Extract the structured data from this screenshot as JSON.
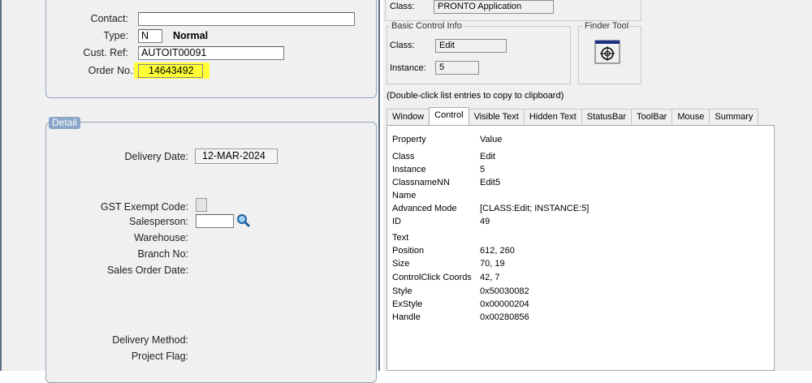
{
  "header": {
    "contact_label": "Contact:",
    "contact_value": "",
    "type_label": "Type:",
    "type_code": "N",
    "type_desc": "Normal",
    "custref_label": "Cust. Ref:",
    "custref_value": "AUTOIT00091",
    "orderno_label": "Order No.:",
    "orderno_value": "14643492"
  },
  "detail": {
    "legend": "Detail",
    "delivery_date_label": "Delivery Date:",
    "delivery_date_value": "12-MAR-2024",
    "gst_label": "GST Exempt Code:",
    "salesperson_label": "Salesperson:",
    "warehouse_label": "Warehouse:",
    "branch_label": "Branch No:",
    "sales_order_date_label": "Sales Order Date:",
    "delivery_method_label": "Delivery Method:",
    "project_flag_label": "Project Flag:"
  },
  "tool": {
    "window_class_label": "Class:",
    "window_class_value": "PRONTO Application",
    "basic_control_title": "Basic Control Info",
    "control_class_label": "Class:",
    "control_class_value": "Edit",
    "instance_label": "Instance:",
    "instance_value": "5",
    "finder_title": "Finder Tool",
    "hint": "(Double-click list entries to copy to clipboard)",
    "tabs": [
      "Window",
      "Control",
      "Visible Text",
      "Hidden Text",
      "StatusBar",
      "ToolBar",
      "Mouse",
      "Summary"
    ],
    "active_tab": "Control",
    "col_property": "Property",
    "col_value": "Value",
    "rows": [
      {
        "p": "Class",
        "v": "Edit"
      },
      {
        "p": "Instance",
        "v": "5"
      },
      {
        "p": "ClassnameNN",
        "v": "Edit5"
      },
      {
        "p": "Name",
        "v": ""
      },
      {
        "p": "Advanced Mode",
        "v": "[CLASS:Edit; INSTANCE:5]"
      },
      {
        "p": "ID",
        "v": "49"
      },
      {
        "p": "Text",
        "v": ""
      },
      {
        "p": "Position",
        "v": "612, 260"
      },
      {
        "p": "Size",
        "v": "70, 19"
      },
      {
        "p": "ControlClick Coords",
        "v": "42, 7"
      },
      {
        "p": "Style",
        "v": "0x50030082"
      },
      {
        "p": "ExStyle",
        "v": "0x00000204"
      },
      {
        "p": "Handle",
        "v": "0x00280856"
      }
    ]
  },
  "colors": {
    "highlight": "#ffff33",
    "border_accent": "#5a6f86",
    "legend_bg": "#8aa6c8"
  },
  "icons": {
    "salesperson_lookup": "magnifier-icon",
    "finder": "crosshair-icon"
  }
}
